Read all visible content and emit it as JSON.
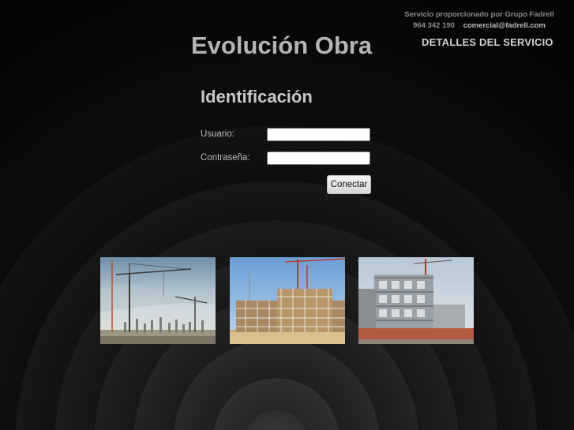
{
  "header": {
    "provider_text": "Servicio proporcionado por Grupo Fadrell",
    "phone": "964 342 190",
    "email": "comercial@fadrell.com",
    "details_link": "DETALLES DEL SERVICIO",
    "title": "Evolución Obra"
  },
  "login": {
    "heading": "Identificación",
    "user_label": "Usuario:",
    "user_value": "",
    "password_label": "Contraseña:",
    "password_value": "",
    "submit_label": "Conectar"
  },
  "gallery": {
    "images": [
      "construction-crane-site-photo",
      "building-scaffolding-photo",
      "multistory-structure-photo"
    ]
  },
  "colors": {
    "background": "#0a0a0a",
    "title_text": "#b5b5b5",
    "link_text": "#cfcfcf"
  }
}
